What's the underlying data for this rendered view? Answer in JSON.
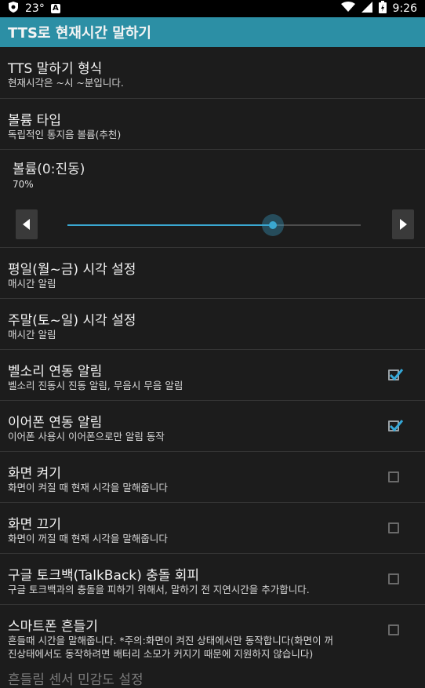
{
  "status_bar": {
    "temperature": "23°",
    "left_icons": [
      "shield-icon",
      "a-icon"
    ],
    "right_icons": [
      "wifi-icon",
      "signal-icon",
      "battery-icon"
    ],
    "time": "9:26"
  },
  "app_bar": {
    "title": "TTS로 현재시간 말하기",
    "color": "#2c8fa5"
  },
  "settings": [
    {
      "title": "TTS 말하기 형식",
      "summary": "현재시각은 ~시 ~분입니다."
    },
    {
      "title": "볼륨 타입",
      "summary": "독립적인 통지음 볼륨(추천)"
    }
  ],
  "volume": {
    "title": "볼륨(0:진동)",
    "value_label": "70%",
    "level": 0.7,
    "accent": "#3aa7d0"
  },
  "settings2": [
    {
      "title": "평일(월~금) 시각 설정",
      "summary": "매시간 알림"
    },
    {
      "title": "주말(토~일) 시각 설정",
      "summary": "매시간 알림"
    },
    {
      "title": "벨소리 연동 알림",
      "summary": "벨소리 진동시 진동 알림, 무음시 무음 알림",
      "checked": true
    },
    {
      "title": "이어폰 연동 알림",
      "summary": "이어폰 사용시 이어폰으로만 알림 동작",
      "checked": true
    },
    {
      "title": "화면 켜기",
      "summary": "화면이 켜질 때 현재 시각을 말해줍니다",
      "checked": false
    },
    {
      "title": "화면 끄기",
      "summary": "화면이 꺼질 때 현재 시각을 말해줍니다",
      "checked": false
    },
    {
      "title": "구글 토크백(TalkBack) 충돌 회피",
      "summary": "구글 토크백과의 충돌을 피하기 위해서, 말하기 전 지연시간을 추가합니다.",
      "checked": false
    },
    {
      "title": "스마트폰 흔들기",
      "summary_line1": "흔들때 시간을 말해줍니다. *주의:화면이 켜진 상태에서만 동작합니다(화면이 꺼",
      "summary_line2": "진상태에서도 동작하려면 배터리 소모가 커지기 때문에 지원하지 않습니다)",
      "checked": false
    }
  ],
  "partial_item": {
    "title": "흔들림 센서 민감도 설정"
  }
}
